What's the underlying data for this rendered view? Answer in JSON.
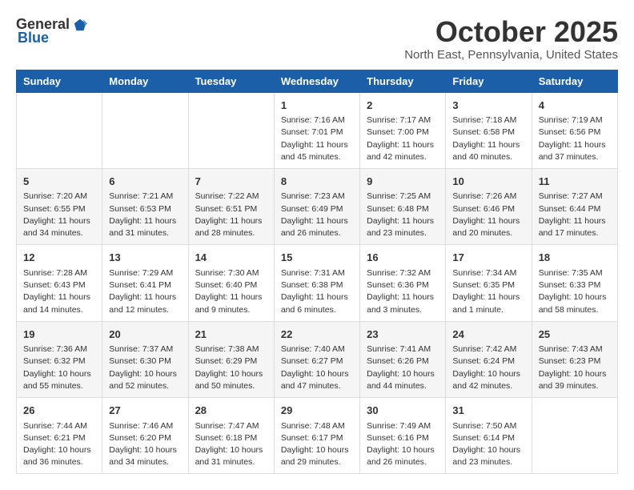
{
  "header": {
    "logo_general": "General",
    "logo_blue": "Blue",
    "month_title": "October 2025",
    "subtitle": "North East, Pennsylvania, United States"
  },
  "days_of_week": [
    "Sunday",
    "Monday",
    "Tuesday",
    "Wednesday",
    "Thursday",
    "Friday",
    "Saturday"
  ],
  "weeks": [
    [
      {
        "day": "",
        "info": ""
      },
      {
        "day": "",
        "info": ""
      },
      {
        "day": "",
        "info": ""
      },
      {
        "day": "1",
        "info": "Sunrise: 7:16 AM\nSunset: 7:01 PM\nDaylight: 11 hours and 45 minutes."
      },
      {
        "day": "2",
        "info": "Sunrise: 7:17 AM\nSunset: 7:00 PM\nDaylight: 11 hours and 42 minutes."
      },
      {
        "day": "3",
        "info": "Sunrise: 7:18 AM\nSunset: 6:58 PM\nDaylight: 11 hours and 40 minutes."
      },
      {
        "day": "4",
        "info": "Sunrise: 7:19 AM\nSunset: 6:56 PM\nDaylight: 11 hours and 37 minutes."
      }
    ],
    [
      {
        "day": "5",
        "info": "Sunrise: 7:20 AM\nSunset: 6:55 PM\nDaylight: 11 hours and 34 minutes."
      },
      {
        "day": "6",
        "info": "Sunrise: 7:21 AM\nSunset: 6:53 PM\nDaylight: 11 hours and 31 minutes."
      },
      {
        "day": "7",
        "info": "Sunrise: 7:22 AM\nSunset: 6:51 PM\nDaylight: 11 hours and 28 minutes."
      },
      {
        "day": "8",
        "info": "Sunrise: 7:23 AM\nSunset: 6:49 PM\nDaylight: 11 hours and 26 minutes."
      },
      {
        "day": "9",
        "info": "Sunrise: 7:25 AM\nSunset: 6:48 PM\nDaylight: 11 hours and 23 minutes."
      },
      {
        "day": "10",
        "info": "Sunrise: 7:26 AM\nSunset: 6:46 PM\nDaylight: 11 hours and 20 minutes."
      },
      {
        "day": "11",
        "info": "Sunrise: 7:27 AM\nSunset: 6:44 PM\nDaylight: 11 hours and 17 minutes."
      }
    ],
    [
      {
        "day": "12",
        "info": "Sunrise: 7:28 AM\nSunset: 6:43 PM\nDaylight: 11 hours and 14 minutes."
      },
      {
        "day": "13",
        "info": "Sunrise: 7:29 AM\nSunset: 6:41 PM\nDaylight: 11 hours and 12 minutes."
      },
      {
        "day": "14",
        "info": "Sunrise: 7:30 AM\nSunset: 6:40 PM\nDaylight: 11 hours and 9 minutes."
      },
      {
        "day": "15",
        "info": "Sunrise: 7:31 AM\nSunset: 6:38 PM\nDaylight: 11 hours and 6 minutes."
      },
      {
        "day": "16",
        "info": "Sunrise: 7:32 AM\nSunset: 6:36 PM\nDaylight: 11 hours and 3 minutes."
      },
      {
        "day": "17",
        "info": "Sunrise: 7:34 AM\nSunset: 6:35 PM\nDaylight: 11 hours and 1 minute."
      },
      {
        "day": "18",
        "info": "Sunrise: 7:35 AM\nSunset: 6:33 PM\nDaylight: 10 hours and 58 minutes."
      }
    ],
    [
      {
        "day": "19",
        "info": "Sunrise: 7:36 AM\nSunset: 6:32 PM\nDaylight: 10 hours and 55 minutes."
      },
      {
        "day": "20",
        "info": "Sunrise: 7:37 AM\nSunset: 6:30 PM\nDaylight: 10 hours and 52 minutes."
      },
      {
        "day": "21",
        "info": "Sunrise: 7:38 AM\nSunset: 6:29 PM\nDaylight: 10 hours and 50 minutes."
      },
      {
        "day": "22",
        "info": "Sunrise: 7:40 AM\nSunset: 6:27 PM\nDaylight: 10 hours and 47 minutes."
      },
      {
        "day": "23",
        "info": "Sunrise: 7:41 AM\nSunset: 6:26 PM\nDaylight: 10 hours and 44 minutes."
      },
      {
        "day": "24",
        "info": "Sunrise: 7:42 AM\nSunset: 6:24 PM\nDaylight: 10 hours and 42 minutes."
      },
      {
        "day": "25",
        "info": "Sunrise: 7:43 AM\nSunset: 6:23 PM\nDaylight: 10 hours and 39 minutes."
      }
    ],
    [
      {
        "day": "26",
        "info": "Sunrise: 7:44 AM\nSunset: 6:21 PM\nDaylight: 10 hours and 36 minutes."
      },
      {
        "day": "27",
        "info": "Sunrise: 7:46 AM\nSunset: 6:20 PM\nDaylight: 10 hours and 34 minutes."
      },
      {
        "day": "28",
        "info": "Sunrise: 7:47 AM\nSunset: 6:18 PM\nDaylight: 10 hours and 31 minutes."
      },
      {
        "day": "29",
        "info": "Sunrise: 7:48 AM\nSunset: 6:17 PM\nDaylight: 10 hours and 29 minutes."
      },
      {
        "day": "30",
        "info": "Sunrise: 7:49 AM\nSunset: 6:16 PM\nDaylight: 10 hours and 26 minutes."
      },
      {
        "day": "31",
        "info": "Sunrise: 7:50 AM\nSunset: 6:14 PM\nDaylight: 10 hours and 23 minutes."
      },
      {
        "day": "",
        "info": ""
      }
    ]
  ]
}
